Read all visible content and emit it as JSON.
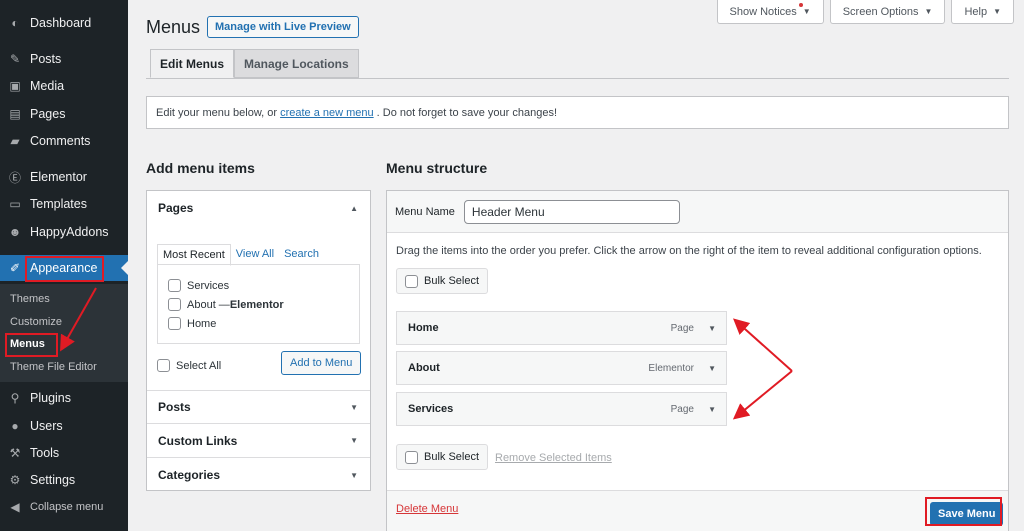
{
  "sidebar": {
    "items": [
      {
        "label": "Dashboard",
        "icon": "dashboard-icon"
      },
      {
        "label": "Posts",
        "icon": "pin-icon"
      },
      {
        "label": "Media",
        "icon": "media-icon"
      },
      {
        "label": "Pages",
        "icon": "pages-icon"
      },
      {
        "label": "Comments",
        "icon": "comment-icon"
      },
      {
        "label": "Elementor",
        "icon": "elementor-icon"
      },
      {
        "label": "Templates",
        "icon": "folder-icon"
      },
      {
        "label": "HappyAddons",
        "icon": "happy-icon"
      },
      {
        "label": "Appearance",
        "icon": "brush-icon"
      },
      {
        "label": "Plugins",
        "icon": "plugin-icon"
      },
      {
        "label": "Users",
        "icon": "user-icon"
      },
      {
        "label": "Tools",
        "icon": "wrench-icon"
      },
      {
        "label": "Settings",
        "icon": "settings-icon"
      },
      {
        "label": "Collapse menu",
        "icon": "collapse-icon"
      }
    ],
    "submenu": [
      "Themes",
      "Customize",
      "Menus",
      "Theme File Editor"
    ]
  },
  "top_buttons": {
    "notices": "Show Notices",
    "screen_options": "Screen Options",
    "help": "Help"
  },
  "header": {
    "title": "Menus",
    "live_preview": "Manage with Live Preview"
  },
  "tabs": {
    "edit": "Edit Menus",
    "manage": "Manage Locations"
  },
  "notice": {
    "before": "Edit your menu below, or",
    "link": "create a new menu",
    "after": ". Do not forget to save your changes!"
  },
  "add_items": {
    "heading": "Add menu items",
    "pages_title": "Pages",
    "page_tabs": [
      "Most Recent",
      "View All",
      "Search"
    ],
    "pages": [
      "Services",
      "About — ",
      "Home"
    ],
    "about_suffix": "Elementor",
    "select_all": "Select All",
    "add_button": "Add to Menu",
    "sections": [
      "Posts",
      "Custom Links",
      "Categories"
    ]
  },
  "structure": {
    "heading": "Menu structure",
    "menu_name_label": "Menu Name",
    "menu_name_value": "Header Menu",
    "help": "Drag the items into the order you prefer. Click the arrow on the right of the item to reveal additional configuration options.",
    "bulk_select": "Bulk Select",
    "items": [
      {
        "title": "Home",
        "type": "Page"
      },
      {
        "title": "About",
        "type": "Elementor"
      },
      {
        "title": "Services",
        "type": "Page"
      }
    ],
    "remove_selected": "Remove Selected Items",
    "delete": "Delete Menu",
    "save": "Save Menu"
  },
  "colors": {
    "accent": "#2271b1",
    "sidebar": "#1d2327",
    "annotation": "#e01b24"
  }
}
